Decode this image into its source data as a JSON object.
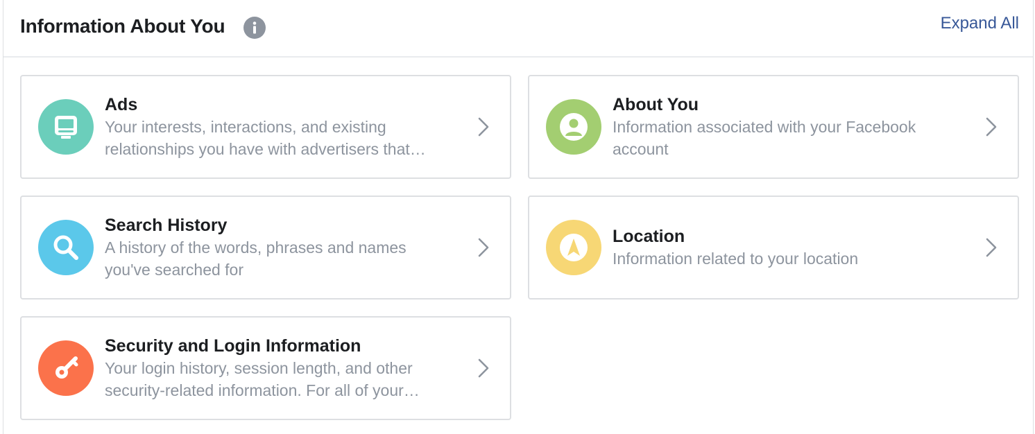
{
  "header": {
    "title": "Information About You",
    "expand_label": "Expand All",
    "info_icon": "info-icon"
  },
  "cards": [
    {
      "title": "Ads",
      "description": "Your interests, interactions, and existing relationships you have with advertisers that…",
      "icon": "ads-icon",
      "color": "#6bcebb"
    },
    {
      "title": "About You",
      "description": "Information associated with your Facebook account",
      "icon": "person-icon",
      "color": "#a3ce71"
    },
    {
      "title": "Search History",
      "description": "A history of the words, phrases and names you've searched for",
      "icon": "search-icon",
      "color": "#5bc8ea"
    },
    {
      "title": "Location",
      "description": "Information related to your location",
      "icon": "location-icon",
      "color": "#f7d775"
    },
    {
      "title": "Security and Login Information",
      "description": "Your login history, session length, and other security-related information. For all of your…",
      "icon": "key-icon",
      "color": "#fb724b"
    }
  ],
  "colors": {
    "link": "#385898",
    "muted": "#8d949e",
    "border": "#dddfe2"
  }
}
